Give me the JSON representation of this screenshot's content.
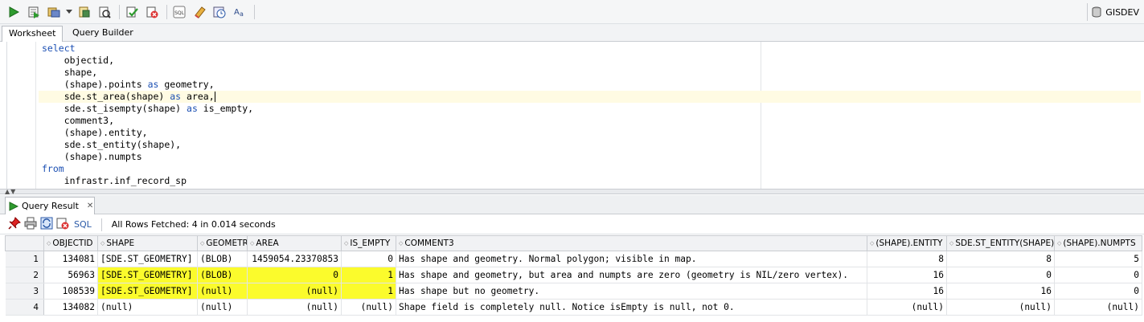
{
  "connection": {
    "label": "GISDEV"
  },
  "tabs": {
    "worksheet": "Worksheet",
    "query_builder": "Query Builder"
  },
  "editor": {
    "lines": [
      [
        {
          "t": "select",
          "k": true
        }
      ],
      [
        {
          "t": "    objectid,",
          "k": false
        }
      ],
      [
        {
          "t": "    shape,",
          "k": false
        }
      ],
      [
        {
          "t": "    (shape).points ",
          "k": false
        },
        {
          "t": "as",
          "k": true
        },
        {
          "t": " geometry,",
          "k": false
        }
      ],
      [
        {
          "t": "    sde.st_area(shape) ",
          "k": false
        },
        {
          "t": "as",
          "k": true
        },
        {
          "t": " area,",
          "k": false
        }
      ],
      [
        {
          "t": "    sde.st_isempty(shape) ",
          "k": false
        },
        {
          "t": "as",
          "k": true
        },
        {
          "t": " is_empty,",
          "k": false
        }
      ],
      [
        {
          "t": "    comment3,",
          "k": false
        }
      ],
      [
        {
          "t": "    (shape).entity,",
          "k": false
        }
      ],
      [
        {
          "t": "    sde.st_entity(shape),",
          "k": false
        }
      ],
      [
        {
          "t": "    (shape).numpts",
          "k": false
        }
      ],
      [
        {
          "t": "from",
          "k": true
        }
      ],
      [
        {
          "t": "    infrastr.inf_record_sp",
          "k": false
        }
      ]
    ],
    "current_line": 4
  },
  "result": {
    "tab_label": "Query Result",
    "sql_link": "SQL",
    "status": "All Rows Fetched: 4 in 0.014 seconds",
    "columns": [
      "OBJECTID",
      "SHAPE",
      "GEOMETRY",
      "AREA",
      "IS_EMPTY",
      "COMMENT3",
      "(SHAPE).ENTITY",
      "SDE.ST_ENTITY(SHAPE)",
      "(SHAPE).NUMPTS"
    ],
    "rows": [
      {
        "n": "1",
        "cells": [
          "134081",
          "[SDE.ST_GEOMETRY]",
          "(BLOB)",
          "1459054.23370853",
          "0",
          "Has shape and geometry. Normal polygon; visible in map.",
          "8",
          "8",
          "5"
        ]
      },
      {
        "n": "2",
        "cells": [
          "56963",
          "[SDE.ST_GEOMETRY]",
          "(BLOB)",
          "0",
          "1",
          "Has shape and geometry, but area and numpts are zero (geometry is NIL/zero vertex).",
          "16",
          "0",
          "0"
        ]
      },
      {
        "n": "3",
        "cells": [
          "108539",
          "[SDE.ST_GEOMETRY]",
          "(null)",
          "(null)",
          "1",
          "Has shape but no geometry.",
          "16",
          "16",
          "0"
        ]
      },
      {
        "n": "4",
        "cells": [
          "134082",
          "(null)",
          "(null)",
          "(null)",
          "(null)",
          "Shape field is completely null. Notice isEmpty is null, not 0.",
          "(null)",
          "(null)",
          "(null)"
        ]
      }
    ],
    "highlight_color": "#fbfb2c"
  }
}
